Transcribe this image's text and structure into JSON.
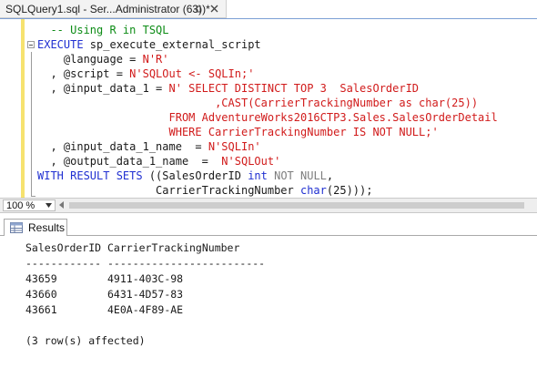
{
  "tab": {
    "title": "SQLQuery1.sql - Ser...Administrator (63))*",
    "pin_icon": "pin-icon",
    "close_icon": "close-icon"
  },
  "editor": {
    "lines": [
      [
        {
          "t": "  -- Using R in TSQL",
          "c": "cmt"
        }
      ],
      [
        {
          "t": "EXECUTE",
          "c": "kw"
        },
        {
          "t": " sp_execute_external_script",
          "c": ""
        }
      ],
      [
        {
          "t": "    @language = ",
          "c": ""
        },
        {
          "t": "N'R'",
          "c": "str"
        }
      ],
      [
        {
          "t": "  , @script = ",
          "c": ""
        },
        {
          "t": "N'SQLOut <- SQLIn;'",
          "c": "str"
        }
      ],
      [
        {
          "t": "  , @input_data_1 = ",
          "c": ""
        },
        {
          "t": "N' SELECT DISTINCT TOP 3  SalesOrderID",
          "c": "str"
        }
      ],
      [
        {
          "t": "                           ,CAST(CarrierTrackingNumber as char(25))",
          "c": "str"
        }
      ],
      [
        {
          "t": "                    FROM AdventureWorks2016CTP3.Sales.SalesOrderDetail",
          "c": "str"
        }
      ],
      [
        {
          "t": "                    WHERE CarrierTrackingNumber IS NOT NULL;'",
          "c": "str"
        }
      ],
      [
        {
          "t": "  , @input_data_1_name  = ",
          "c": ""
        },
        {
          "t": "N'SQLIn'",
          "c": "str"
        }
      ],
      [
        {
          "t": "  , @output_data_1_name  =  ",
          "c": ""
        },
        {
          "t": "N'SQLOut'",
          "c": "str"
        }
      ],
      [
        {
          "t": "WITH RESULT SETS",
          "c": "kw"
        },
        {
          "t": " ((SalesOrderID ",
          "c": ""
        },
        {
          "t": "int",
          "c": "kw"
        },
        {
          "t": " ",
          "c": ""
        },
        {
          "t": "NOT NULL",
          "c": "gry"
        },
        {
          "t": ",",
          "c": ""
        }
      ],
      [
        {
          "t": "                  CarrierTrackingNumber ",
          "c": ""
        },
        {
          "t": "char",
          "c": "kw"
        },
        {
          "t": "(25)));",
          "c": ""
        }
      ]
    ]
  },
  "statusbar": {
    "zoom": "100 %"
  },
  "results": {
    "tab_label": "Results",
    "lines": [
      "SalesOrderID CarrierTrackingNumber",
      "------------ -------------------------",
      "43659        4911-403C-98",
      "43660        6431-4D57-83",
      "43661        4E0A-4F89-AE",
      "",
      "(3 row(s) affected)"
    ]
  }
}
